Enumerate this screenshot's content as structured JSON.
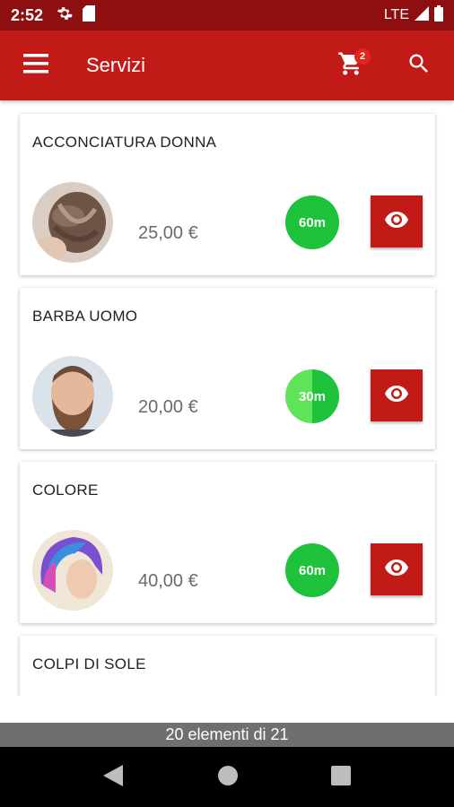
{
  "status_bar": {
    "time": "2:52",
    "network": "LTE"
  },
  "app_bar": {
    "title": "Servizi",
    "cart_count": "2"
  },
  "services": [
    {
      "name": "ACCONCIATURA DONNA",
      "price": "25,00 €",
      "duration": "60m"
    },
    {
      "name": "BARBA UOMO",
      "price": "20,00 €",
      "duration": "30m"
    },
    {
      "name": "COLORE",
      "price": "40,00 €",
      "duration": "60m"
    },
    {
      "name": "COLPI DI SOLE",
      "price": "",
      "duration": ""
    }
  ],
  "footer": {
    "counter": "20 elementi di 21"
  },
  "colors": {
    "primary": "#c21b17",
    "status_bar": "#8e0f0f",
    "duration_green": "#1ec23b",
    "duration_light_green": "#5fe35a"
  }
}
